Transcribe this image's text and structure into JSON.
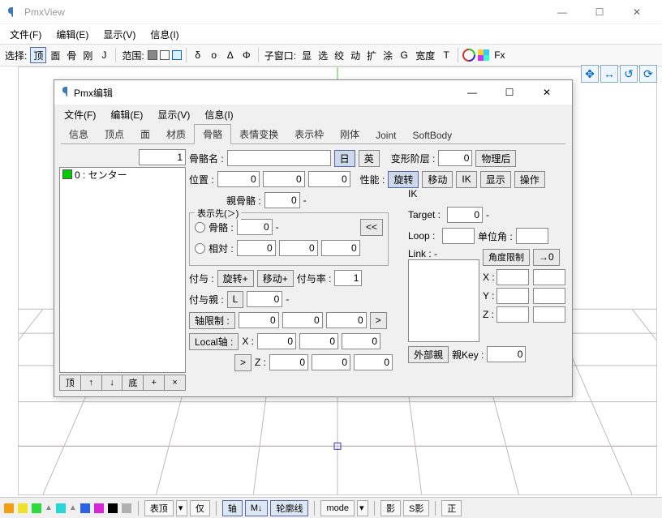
{
  "main": {
    "title": "PmxView",
    "menu": {
      "file": "文件(F)",
      "edit": "编辑(E)",
      "view": "显示(V)",
      "info": "信息(I)"
    },
    "toolbar": {
      "select_label": "选择:",
      "sel_items": [
        "顶",
        "面",
        "骨",
        "刚",
        "J"
      ],
      "range_label": "范围:",
      "greek": [
        "δ",
        "ο",
        "Δ",
        "Φ"
      ],
      "child_label": "子窗口:",
      "child_items": [
        "显",
        "选",
        "绞",
        "动",
        "扩",
        "涂",
        "G",
        "宽度",
        "T"
      ],
      "fx": "Fx"
    }
  },
  "status": {
    "items": [
      "表顶",
      "▾",
      "仅",
      "轴",
      "M↓",
      "轮廓线",
      "mode",
      "▾",
      "影",
      "S影",
      "正"
    ],
    "colors": [
      "#f39d11",
      "#f0e02a",
      "#2ddc3c",
      "#27d6d6",
      "#2b62e6",
      "#d726d5",
      "#000000",
      "#b0b0b0"
    ]
  },
  "editor": {
    "title": "Pmx编辑",
    "menu": {
      "file": "文件(F)",
      "edit": "编辑(E)",
      "view": "显示(V)",
      "info": "信息(I)"
    },
    "tabs": [
      "信息",
      "顶点",
      "面",
      "材质",
      "骨骼",
      "表情变换",
      "表示枠",
      "刚体",
      "Joint",
      "SoftBody"
    ],
    "active_tab": 4,
    "list_index": "1",
    "list": [
      {
        "label": "0 : センター"
      }
    ],
    "list_btns": [
      "顶",
      "↑",
      "↓",
      "底",
      "+",
      "×"
    ],
    "bone": {
      "name_label": "骨骼名 :",
      "name": "",
      "jp": "日",
      "en": "英",
      "deform_label": "变形阶层 :",
      "deform": "0",
      "physics_after": "物理后",
      "pos_label": "位置 :",
      "px": "0",
      "py": "0",
      "pz": "0",
      "perf_label": "性能 :",
      "perf_btns": [
        "旋转",
        "移动",
        "IK",
        "显示",
        "操作"
      ],
      "parent_label": "親骨骼 :",
      "parent": "0",
      "dash": "-",
      "disp_label": "表示先(＞)",
      "disp_bone_label": "骨骼 :",
      "disp_bone": "0",
      "disp_rel_label": "相対 :",
      "rel_x": "0",
      "rel_y": "0",
      "rel_z": "0",
      "back_btn": "<<",
      "grant_label": "付与 :",
      "grant_rot": "旋转+",
      "grant_mov": "移动+",
      "grant_rate_label": "付与率 :",
      "grant_rate": "1",
      "grant_parent_label": "付与親 :",
      "grant_l": "L",
      "grant_parent": "0",
      "axis_limit_label": "轴限制 :",
      "al_x": "0",
      "al_y": "0",
      "al_z": "0",
      "arrow": ">",
      "local_axis_label": "Local轴 :",
      "lx_label": "X :",
      "lx1": "0",
      "lx2": "0",
      "lx3": "0",
      "lz_label": "Z :",
      "lz1": "0",
      "lz2": "0",
      "lz3": "0",
      "larrow": ">",
      "ik": {
        "label": "IK",
        "target_label": "Target :",
        "target": "0",
        "loop_label": "Loop :",
        "loop": "",
        "unit_label": "单位角 :",
        "unit": "",
        "link_label": "Link : -",
        "angle_limit": "角度限制",
        "to0": "→0",
        "xlabel": "X :",
        "ylabel": "Y :",
        "zlabel": "Z :",
        "x1": "",
        "x2": "",
        "y1": "",
        "y2": "",
        "z1": "",
        "z2": ""
      },
      "ext_parent": "外部親",
      "parent_key_label": "親Key :",
      "parent_key": "0"
    }
  }
}
